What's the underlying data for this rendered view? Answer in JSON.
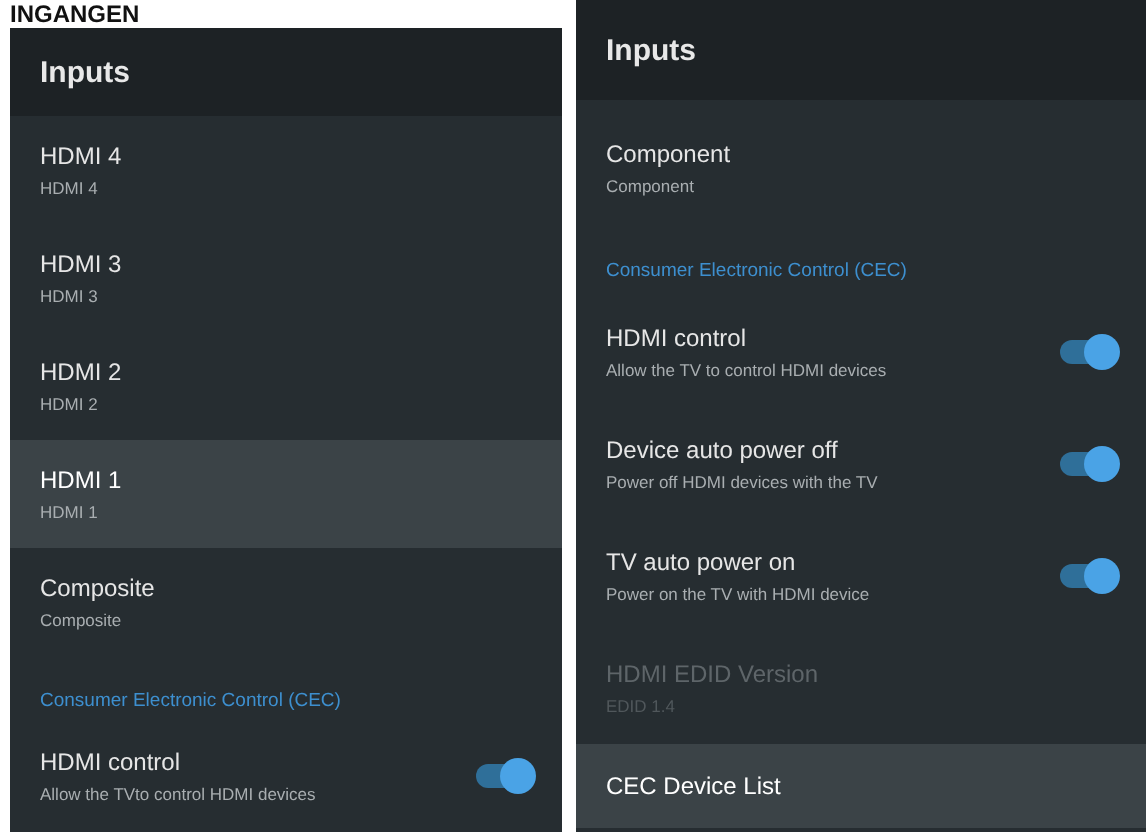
{
  "page_heading": "INGANGEN",
  "panels": [
    {
      "title": "Inputs",
      "items": [
        {
          "kind": "input",
          "title": "HDMI 4",
          "subtitle": "HDMI 4",
          "selected": false,
          "disabled": false
        },
        {
          "kind": "input",
          "title": "HDMI 3",
          "subtitle": "HDMI 3",
          "selected": false,
          "disabled": false
        },
        {
          "kind": "input",
          "title": "HDMI 2",
          "subtitle": "HDMI 2",
          "selected": false,
          "disabled": false
        },
        {
          "kind": "input",
          "title": "HDMI 1",
          "subtitle": "HDMI 1",
          "selected": true,
          "disabled": false
        },
        {
          "kind": "input",
          "title": "Composite",
          "subtitle": "Composite",
          "selected": false,
          "disabled": false
        },
        {
          "kind": "section",
          "title": "Consumer Electronic Control (CEC)"
        },
        {
          "kind": "toggle",
          "title": "HDMI control",
          "subtitle": "Allow the TVto control HDMI devices",
          "on": true,
          "selected": false,
          "disabled": false
        }
      ]
    },
    {
      "title": "Inputs",
      "items": [
        {
          "kind": "input",
          "title": "Component",
          "subtitle": "Component",
          "selected": false,
          "disabled": false
        },
        {
          "kind": "section",
          "title": "Consumer Electronic Control (CEC)"
        },
        {
          "kind": "toggle",
          "title": "HDMI control",
          "subtitle": "Allow the TV to control HDMI devices",
          "on": true,
          "selected": false,
          "disabled": false
        },
        {
          "kind": "toggle",
          "title": "Device auto power off",
          "subtitle": "Power off HDMI devices with the TV",
          "on": true,
          "selected": false,
          "disabled": false
        },
        {
          "kind": "toggle",
          "title": "TV auto power on",
          "subtitle": "Power on the TV with HDMI device",
          "on": true,
          "selected": false,
          "disabled": false
        },
        {
          "kind": "input",
          "title": "HDMI EDID Version",
          "subtitle": "EDID 1.4",
          "selected": false,
          "disabled": true
        },
        {
          "kind": "link",
          "title": "CEC Device List",
          "selected": true,
          "disabled": false
        }
      ]
    }
  ]
}
